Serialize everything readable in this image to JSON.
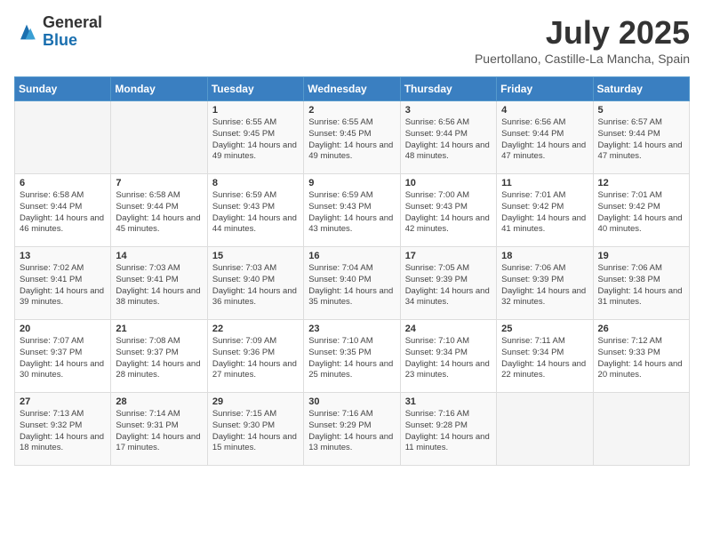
{
  "logo": {
    "general": "General",
    "blue": "Blue"
  },
  "header": {
    "month": "July 2025",
    "location": "Puertollano, Castille-La Mancha, Spain"
  },
  "weekdays": [
    "Sunday",
    "Monday",
    "Tuesday",
    "Wednesday",
    "Thursday",
    "Friday",
    "Saturday"
  ],
  "weeks": [
    [
      {
        "day": "",
        "info": ""
      },
      {
        "day": "",
        "info": ""
      },
      {
        "day": "1",
        "info": "Sunrise: 6:55 AM\nSunset: 9:45 PM\nDaylight: 14 hours and 49 minutes."
      },
      {
        "day": "2",
        "info": "Sunrise: 6:55 AM\nSunset: 9:45 PM\nDaylight: 14 hours and 49 minutes."
      },
      {
        "day": "3",
        "info": "Sunrise: 6:56 AM\nSunset: 9:44 PM\nDaylight: 14 hours and 48 minutes."
      },
      {
        "day": "4",
        "info": "Sunrise: 6:56 AM\nSunset: 9:44 PM\nDaylight: 14 hours and 47 minutes."
      },
      {
        "day": "5",
        "info": "Sunrise: 6:57 AM\nSunset: 9:44 PM\nDaylight: 14 hours and 47 minutes."
      }
    ],
    [
      {
        "day": "6",
        "info": "Sunrise: 6:58 AM\nSunset: 9:44 PM\nDaylight: 14 hours and 46 minutes."
      },
      {
        "day": "7",
        "info": "Sunrise: 6:58 AM\nSunset: 9:44 PM\nDaylight: 14 hours and 45 minutes."
      },
      {
        "day": "8",
        "info": "Sunrise: 6:59 AM\nSunset: 9:43 PM\nDaylight: 14 hours and 44 minutes."
      },
      {
        "day": "9",
        "info": "Sunrise: 6:59 AM\nSunset: 9:43 PM\nDaylight: 14 hours and 43 minutes."
      },
      {
        "day": "10",
        "info": "Sunrise: 7:00 AM\nSunset: 9:43 PM\nDaylight: 14 hours and 42 minutes."
      },
      {
        "day": "11",
        "info": "Sunrise: 7:01 AM\nSunset: 9:42 PM\nDaylight: 14 hours and 41 minutes."
      },
      {
        "day": "12",
        "info": "Sunrise: 7:01 AM\nSunset: 9:42 PM\nDaylight: 14 hours and 40 minutes."
      }
    ],
    [
      {
        "day": "13",
        "info": "Sunrise: 7:02 AM\nSunset: 9:41 PM\nDaylight: 14 hours and 39 minutes."
      },
      {
        "day": "14",
        "info": "Sunrise: 7:03 AM\nSunset: 9:41 PM\nDaylight: 14 hours and 38 minutes."
      },
      {
        "day": "15",
        "info": "Sunrise: 7:03 AM\nSunset: 9:40 PM\nDaylight: 14 hours and 36 minutes."
      },
      {
        "day": "16",
        "info": "Sunrise: 7:04 AM\nSunset: 9:40 PM\nDaylight: 14 hours and 35 minutes."
      },
      {
        "day": "17",
        "info": "Sunrise: 7:05 AM\nSunset: 9:39 PM\nDaylight: 14 hours and 34 minutes."
      },
      {
        "day": "18",
        "info": "Sunrise: 7:06 AM\nSunset: 9:39 PM\nDaylight: 14 hours and 32 minutes."
      },
      {
        "day": "19",
        "info": "Sunrise: 7:06 AM\nSunset: 9:38 PM\nDaylight: 14 hours and 31 minutes."
      }
    ],
    [
      {
        "day": "20",
        "info": "Sunrise: 7:07 AM\nSunset: 9:37 PM\nDaylight: 14 hours and 30 minutes."
      },
      {
        "day": "21",
        "info": "Sunrise: 7:08 AM\nSunset: 9:37 PM\nDaylight: 14 hours and 28 minutes."
      },
      {
        "day": "22",
        "info": "Sunrise: 7:09 AM\nSunset: 9:36 PM\nDaylight: 14 hours and 27 minutes."
      },
      {
        "day": "23",
        "info": "Sunrise: 7:10 AM\nSunset: 9:35 PM\nDaylight: 14 hours and 25 minutes."
      },
      {
        "day": "24",
        "info": "Sunrise: 7:10 AM\nSunset: 9:34 PM\nDaylight: 14 hours and 23 minutes."
      },
      {
        "day": "25",
        "info": "Sunrise: 7:11 AM\nSunset: 9:34 PM\nDaylight: 14 hours and 22 minutes."
      },
      {
        "day": "26",
        "info": "Sunrise: 7:12 AM\nSunset: 9:33 PM\nDaylight: 14 hours and 20 minutes."
      }
    ],
    [
      {
        "day": "27",
        "info": "Sunrise: 7:13 AM\nSunset: 9:32 PM\nDaylight: 14 hours and 18 minutes."
      },
      {
        "day": "28",
        "info": "Sunrise: 7:14 AM\nSunset: 9:31 PM\nDaylight: 14 hours and 17 minutes."
      },
      {
        "day": "29",
        "info": "Sunrise: 7:15 AM\nSunset: 9:30 PM\nDaylight: 14 hours and 15 minutes."
      },
      {
        "day": "30",
        "info": "Sunrise: 7:16 AM\nSunset: 9:29 PM\nDaylight: 14 hours and 13 minutes."
      },
      {
        "day": "31",
        "info": "Sunrise: 7:16 AM\nSunset: 9:28 PM\nDaylight: 14 hours and 11 minutes."
      },
      {
        "day": "",
        "info": ""
      },
      {
        "day": "",
        "info": ""
      }
    ]
  ]
}
